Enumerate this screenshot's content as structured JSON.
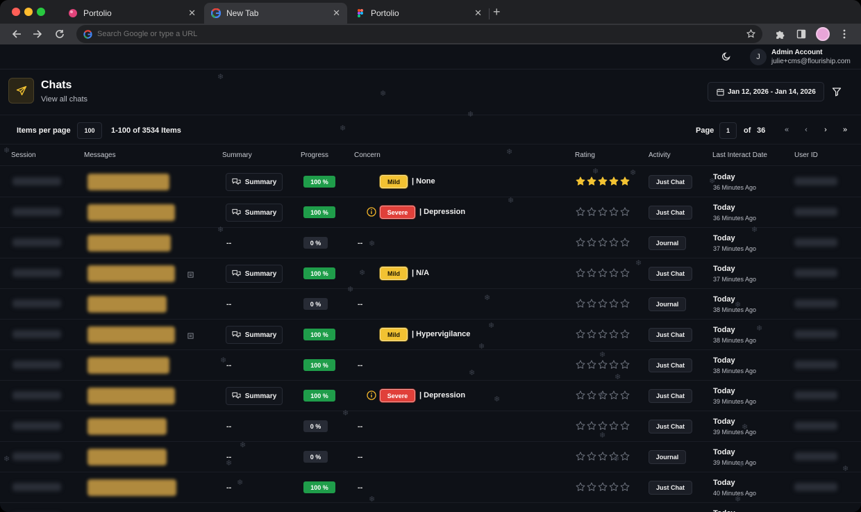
{
  "browser": {
    "tabs": [
      {
        "title": "Portolio",
        "favicon": "portolio-favicon",
        "active": false
      },
      {
        "title": "New Tab",
        "favicon": "google-favicon",
        "active": true
      },
      {
        "title": "Portolio",
        "favicon": "figma-favicon",
        "active": false
      }
    ],
    "omnibox_placeholder": "Search Google or type a URL"
  },
  "account": {
    "initial": "J",
    "name": "Admin Account",
    "email": "julie+cms@flouriship.com"
  },
  "header": {
    "title": "Chats",
    "subtitle": "View all chats",
    "date_range": "Jan 12, 2026 - Jan 14, 2026"
  },
  "pager": {
    "items_per_page_label": "Items per page",
    "items_per_page": "100",
    "range_text": "1-100 of 3534 Items",
    "page_label": "Page",
    "page": "1",
    "of_label": "of",
    "total_pages": "36",
    "first": "«",
    "prev": "‹",
    "next": "›",
    "last": "»"
  },
  "columns": [
    "Session",
    "Messages",
    "Summary",
    "Progress",
    "Concern",
    "Rating",
    "Activity",
    "Last Interact Date",
    "User ID"
  ],
  "summary_label": "Summary",
  "dash": "--",
  "rows": [
    {
      "summary": true,
      "progress": "100 %",
      "full": true,
      "severity": "Mild",
      "concern": "None",
      "warn": false,
      "rating": 5,
      "activity": "Just Chat",
      "day": "Today",
      "ago": "36 Minutes Ago",
      "msg_w": 118,
      "mini": false
    },
    {
      "summary": true,
      "progress": "100 %",
      "full": true,
      "severity": "Severe",
      "concern": "Depression",
      "warn": true,
      "rating": 0,
      "activity": "Just Chat",
      "day": "Today",
      "ago": "36 Minutes Ago",
      "msg_w": 126,
      "mini": false
    },
    {
      "summary": false,
      "progress": "0 %",
      "full": false,
      "severity": "",
      "concern": "",
      "warn": false,
      "rating": 0,
      "activity": "Journal",
      "day": "Today",
      "ago": "37 Minutes Ago",
      "msg_w": 120,
      "mini": false
    },
    {
      "summary": true,
      "progress": "100 %",
      "full": true,
      "severity": "Mild",
      "concern": "N/A",
      "warn": false,
      "rating": 0,
      "activity": "Just Chat",
      "day": "Today",
      "ago": "37 Minutes Ago",
      "msg_w": 126,
      "mini": true
    },
    {
      "summary": false,
      "progress": "0 %",
      "full": false,
      "severity": "",
      "concern": "",
      "warn": false,
      "rating": 0,
      "activity": "Journal",
      "day": "Today",
      "ago": "38 Minutes Ago",
      "msg_w": 114,
      "mini": false
    },
    {
      "summary": true,
      "progress": "100 %",
      "full": true,
      "severity": "Mild",
      "concern": "Hypervigilance",
      "warn": false,
      "rating": 0,
      "activity": "Just Chat",
      "day": "Today",
      "ago": "38 Minutes Ago",
      "msg_w": 126,
      "mini": true
    },
    {
      "summary": false,
      "progress": "100 %",
      "full": true,
      "severity": "",
      "concern": "",
      "warn": false,
      "rating": 0,
      "activity": "Just Chat",
      "day": "Today",
      "ago": "38 Minutes Ago",
      "msg_w": 118,
      "mini": false
    },
    {
      "summary": true,
      "progress": "100 %",
      "full": true,
      "severity": "Severe",
      "concern": "Depression",
      "warn": true,
      "rating": 0,
      "activity": "Just Chat",
      "day": "Today",
      "ago": "39 Minutes Ago",
      "msg_w": 126,
      "mini": false
    },
    {
      "summary": false,
      "progress": "0 %",
      "full": false,
      "severity": "",
      "concern": "",
      "warn": false,
      "rating": 0,
      "activity": "Just Chat",
      "day": "Today",
      "ago": "39 Minutes Ago",
      "msg_w": 114,
      "mini": false
    },
    {
      "summary": false,
      "progress": "0 %",
      "full": false,
      "severity": "",
      "concern": "",
      "warn": false,
      "rating": 0,
      "activity": "Journal",
      "day": "Today",
      "ago": "39 Minutes Ago",
      "msg_w": 114,
      "mini": false
    },
    {
      "summary": false,
      "progress": "100 %",
      "full": true,
      "severity": "",
      "concern": "",
      "warn": false,
      "rating": 0,
      "activity": "Just Chat",
      "day": "Today",
      "ago": "40 Minutes Ago",
      "msg_w": 128,
      "mini": false
    },
    {
      "summary": false,
      "progress": "",
      "full": false,
      "severity": "",
      "concern": "",
      "warn": false,
      "rating": 0,
      "activity": "",
      "day": "Today",
      "ago": "",
      "msg_w": 0,
      "mini": false
    }
  ],
  "colors": {
    "accent_gold": "#f2c232",
    "severe_red": "#e0403a",
    "progress_green": "#1f9d4a",
    "background": "#0e1117"
  }
}
